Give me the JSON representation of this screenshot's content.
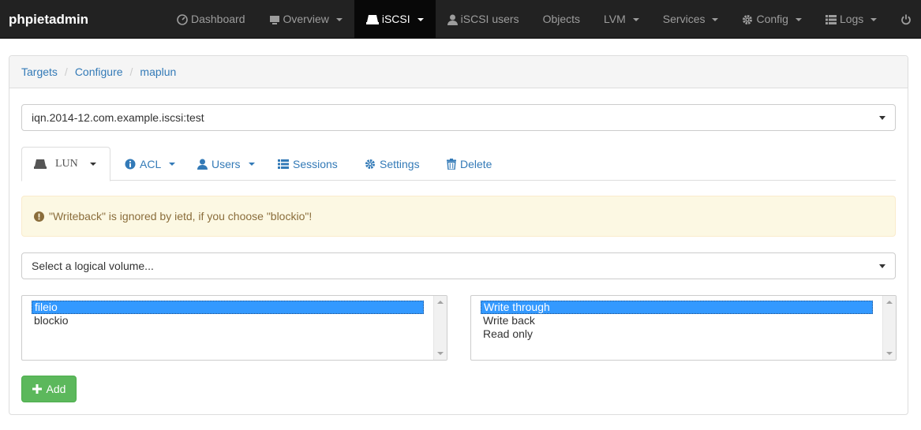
{
  "app": {
    "brand": "phpietadmin"
  },
  "navbar": {
    "items": [
      {
        "label": "Dashboard",
        "icon": "dashboard-icon",
        "dropdown": false
      },
      {
        "label": "Overview",
        "icon": "monitor-icon",
        "dropdown": true
      },
      {
        "label": "iSCSI",
        "icon": "hdd-icon",
        "dropdown": true,
        "active": true
      },
      {
        "label": "iSCSI users",
        "icon": "user-icon",
        "dropdown": false
      },
      {
        "label": "Objects",
        "icon": "",
        "dropdown": false
      },
      {
        "label": "LVM",
        "icon": "",
        "dropdown": true
      },
      {
        "label": "Services",
        "icon": "",
        "dropdown": true
      },
      {
        "label": "Config",
        "icon": "gear-icon",
        "dropdown": true
      },
      {
        "label": "Logs",
        "icon": "list-icon",
        "dropdown": true
      },
      {
        "label": "",
        "icon": "power-icon",
        "dropdown": true
      }
    ]
  },
  "breadcrumb": {
    "items": [
      "Targets",
      "Configure",
      "maplun"
    ]
  },
  "target_select": {
    "value": "iqn.2014-12.com.example.iscsi:test"
  },
  "tabs": [
    {
      "label": "LUN",
      "icon": "hdd-icon",
      "active": true
    },
    {
      "label": "ACL",
      "icon": "info-circle-icon"
    },
    {
      "label": "Users",
      "icon": "user-icon"
    },
    {
      "label": "Sessions",
      "icon": "list-icon"
    },
    {
      "label": "Settings",
      "icon": "gear-icon"
    },
    {
      "label": "Delete",
      "icon": "trash-icon"
    }
  ],
  "alert": {
    "text": "\"Writeback\" is ignored by ietd, if you choose \"blockio\"!"
  },
  "volume_select": {
    "placeholder": "Select a logical volume..."
  },
  "io_type": {
    "options": [
      "fileio",
      "blockio"
    ],
    "selected": "fileio"
  },
  "write_mode": {
    "options": [
      "Write through",
      "Write back",
      "Read only"
    ],
    "selected": "Write through"
  },
  "add_button": {
    "label": "Add"
  },
  "colors": {
    "navbar": "#222222",
    "link": "#337ab7",
    "success": "#5cb85c",
    "warning_bg": "#fcf8e3",
    "warning_text": "#8a6d3b",
    "selection": "#3399ff"
  }
}
